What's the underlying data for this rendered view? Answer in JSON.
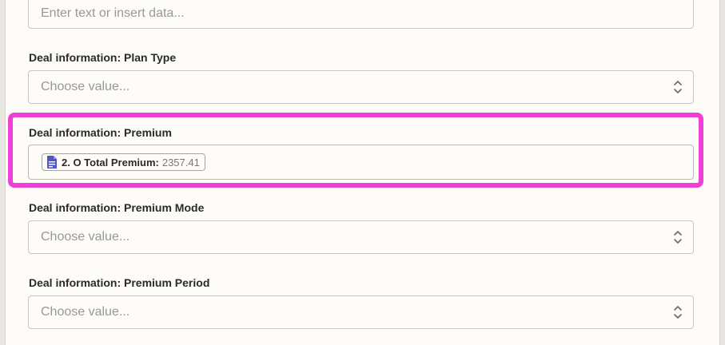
{
  "fields": [
    {
      "label": "",
      "placeholder": "Enter text or insert data...",
      "type": "text"
    },
    {
      "label": "Deal information: Plan Type",
      "placeholder": "Choose value...",
      "type": "select"
    },
    {
      "label": "Deal information: Premium",
      "type": "text",
      "pill": {
        "icon": "document-icon",
        "name": "2. O Total Premium:",
        "value": "2357.41"
      }
    },
    {
      "label": "Deal information: Premium Mode",
      "placeholder": "Choose value...",
      "type": "select"
    },
    {
      "label": "Deal information: Premium Period",
      "placeholder": "Choose value...",
      "type": "select"
    }
  ],
  "colors": {
    "highlight": "#ee3fd6",
    "pill_icon": "#4f56c9"
  }
}
